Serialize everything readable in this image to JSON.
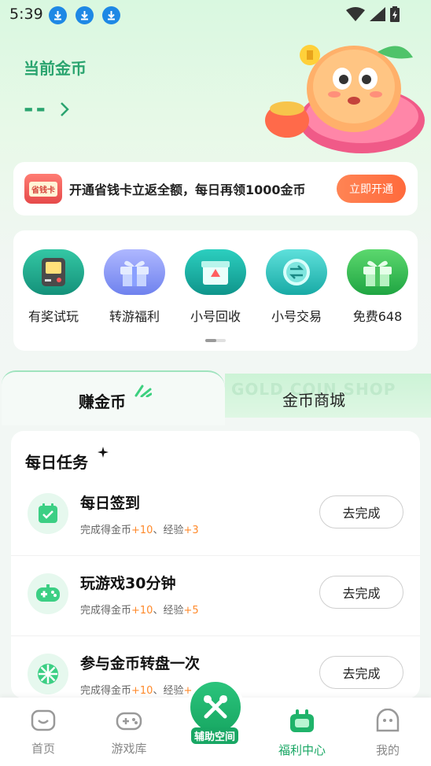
{
  "status_bar": {
    "time": "5:39"
  },
  "header": {
    "coin_title": "当前金币",
    "coin_value": "--"
  },
  "banner": {
    "badge": "省钱卡",
    "text": "开通省钱卡立返全额，每日再领1000金币",
    "button": "立即开通"
  },
  "features": [
    {
      "label": "有奖试玩",
      "icon": "game-console-icon",
      "color": "#1fa98c"
    },
    {
      "label": "转游福利",
      "icon": "gift-icon",
      "color": "#7c8cf0"
    },
    {
      "label": "小号回收",
      "icon": "recycle-box-icon",
      "color": "#15a6a0"
    },
    {
      "label": "小号交易",
      "icon": "trade-coin-icon",
      "color": "#1cb8b2"
    },
    {
      "label": "免费648",
      "icon": "gift-icon",
      "color": "#2bbf56"
    }
  ],
  "tabs": {
    "earn": "赚金币",
    "shop": "金币商城",
    "shop_bg": "GOLD COIN SHOP"
  },
  "tasks": {
    "title": "每日任务",
    "items": [
      {
        "name": "每日签到",
        "reward_prefix": "完成得金币",
        "coin": "+10",
        "sep": "、经验",
        "exp": "+3",
        "button": "去完成",
        "icon": "calendar-check-icon"
      },
      {
        "name": "玩游戏30分钟",
        "reward_prefix": "完成得金币",
        "coin": "+10",
        "sep": "、经验",
        "exp": "+5",
        "button": "去完成",
        "icon": "gamepad-icon"
      },
      {
        "name": "参与金币转盘一次",
        "reward_prefix": "完成得金币",
        "coin": "+10",
        "sep": "、经验",
        "exp": "+",
        "button": "去完成",
        "icon": "wheel-icon"
      }
    ]
  },
  "bottom_nav": {
    "home": "首页",
    "library": "游戏库",
    "assist": "辅助空间",
    "welfare": "福利中心",
    "mine": "我的"
  },
  "colors": {
    "brand_green": "#2aa46f",
    "accent_orange": "#ff6a3c",
    "active_nav": "#19a764"
  }
}
